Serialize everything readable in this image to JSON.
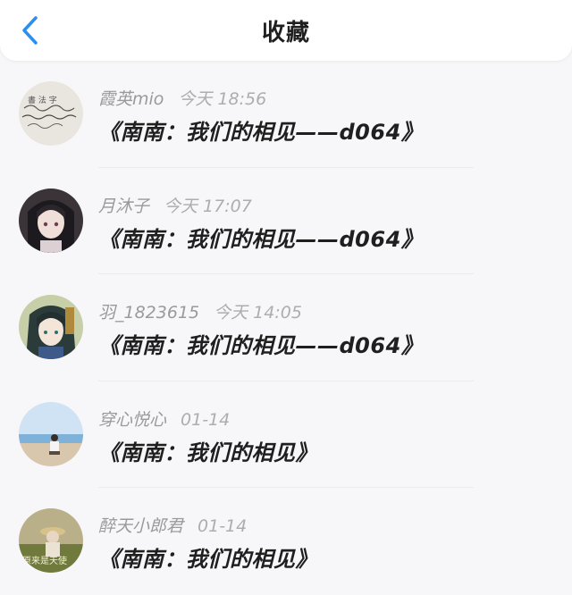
{
  "header": {
    "title": "收藏",
    "back_icon": "chevron-left-icon",
    "accent_color": "#2b8ef0"
  },
  "items": [
    {
      "user": "霞英mio",
      "time": "今天 18:56",
      "text": "《南南：我们的相见——d064》"
    },
    {
      "user": "月沐子",
      "time": "今天 17:07",
      "text": "《南南：我们的相见——d064》"
    },
    {
      "user": "羽_1823615",
      "time": "今天 14:05",
      "text": "《南南：我们的相见——d064》"
    },
    {
      "user": "穿心悦心",
      "time": "01-14",
      "text": "《南南：我们的相见》"
    },
    {
      "user": "醉天小郎君",
      "time": "01-14",
      "text": "《南南：我们的相见》"
    }
  ]
}
